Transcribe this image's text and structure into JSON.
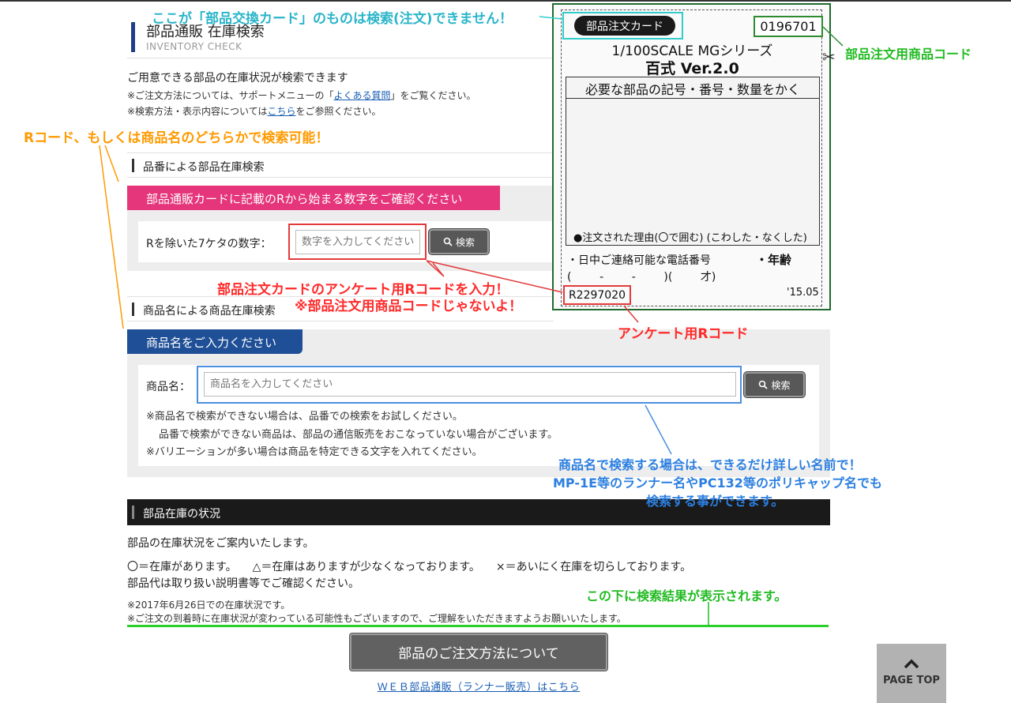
{
  "header": {
    "title": "部品通販 在庫検索",
    "subtitle": "INVENTORY CHECK"
  },
  "intro": {
    "lead": "ご用意できる部品の在庫状況が検索できます",
    "note1_pre": "※ご注文方法については、サポートメニューの「",
    "note1_link": "よくある質問",
    "note1_post": "」をご覧ください。",
    "note2_pre": "※検索方法・表示内容については",
    "note2_link": "こちら",
    "note2_post": "をご参照ください。"
  },
  "part_search": {
    "heading": "品番による部品在庫検索",
    "tab": "部品通販カードに記載のRから始まる数字をご確認ください",
    "label": "Rを除いた7ケタの数字：",
    "placeholder": "数字を入力してください",
    "button": "検索"
  },
  "name_search": {
    "heading": "商品名による商品在庫検索",
    "tab": "商品名をご入力ください",
    "label": "商品名：",
    "placeholder": "商品名を入力してください",
    "button": "検索",
    "note1": "※商品名で検索ができない場合は、品番での検索をお試しください。",
    "note2": "品番で検索ができない商品は、部品の通信販売をおこなっていない場合がございます。",
    "note3": "※バリエーションが多い場合は商品を特定できる文字を入れてください。"
  },
  "stock": {
    "heading": "部品在庫の状況",
    "lead": "部品の在庫状況をご案内いたします。",
    "legend_ok": "〇＝在庫があります。",
    "legend_low": "△＝在庫はありますが少なくなっております。",
    "legend_none": "×＝あいにく在庫を切らしております。",
    "price_note": "部品代は取り扱い説明書等でご確認ください。",
    "date_note": "※2017年6月26日での在庫状況です。",
    "arrival_note": "※ご注文の到着時に在庫状況が変わっている可能性もございますので、ご理解をいただきますようお願いいたします。"
  },
  "footer": {
    "order_button": "部品のご注文方法について",
    "web_link": "ＷＥＢ部品通販（ランナー販売）はこちら",
    "page_top": "PAGE TOP"
  },
  "card": {
    "tag": "部品注文カード",
    "code": "0196701",
    "line1": "1/100SCALE  MGシリーズ",
    "line2": "百式 Ver.2.0",
    "req_head": "必要な部品の記号・番号・数量をかく",
    "reason": "●注文された理由(〇で囲む) (こわした・なくした)",
    "phone": "・日中ご連絡可能な電話番号",
    "age": "・年齢",
    "phone_blank": "(        -        -        )(        才)",
    "r_code": "R2297020",
    "year": "'15.05"
  },
  "annotations": {
    "cyan": "ここが「部品交換カード」のものは検索(注文)できません！",
    "green_code": "部品注文用商品コード",
    "orange": "Rコード、もしくは商品名のどちらかで検索可能！",
    "red1": "部品注文カードのアンケート用Rコードを入力！",
    "red2": "※部品注文用商品コードじゃないよ！",
    "red3": "アンケート用Rコード",
    "blue1": "商品名で検索する場合は、できるだけ詳しい名前で！",
    "blue2": "MP-1E等のランナー名やPC132等のポリキャップ名でも",
    "blue3": "検索する事ができます。",
    "green_result": "この下に検索結果が表示されます。"
  },
  "colors": {
    "accent_pink": "#e5357b",
    "accent_blue": "#1f4f96",
    "annotation_green": "#22bb22",
    "annotation_red": "#ff2a2a",
    "annotation_orange": "#ff9a00",
    "annotation_blue": "#2b7fe0"
  }
}
